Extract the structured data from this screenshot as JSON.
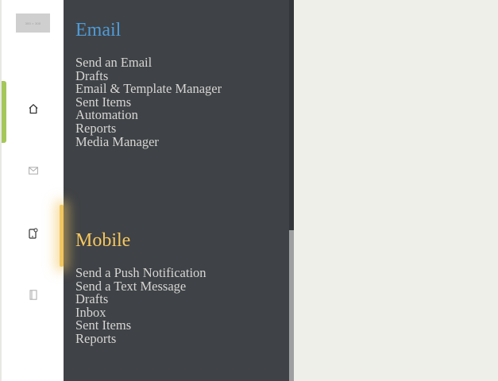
{
  "rail": {
    "logo_text": "300 × 300",
    "items": [
      {
        "icon": "home-icon",
        "name": "home"
      },
      {
        "icon": "mail-icon",
        "name": "email"
      },
      {
        "icon": "mobile-icon",
        "name": "mobile"
      },
      {
        "icon": "book-icon",
        "name": "book"
      }
    ],
    "active_color": "#a5c75a"
  },
  "email": {
    "title": "Email",
    "color": "#4f9bd8",
    "items": [
      "Send an Email",
      "Drafts",
      "Email & Template Manager",
      "Sent Items",
      "Automation",
      "Reports",
      "Media Manager"
    ]
  },
  "mobile": {
    "title": "Mobile",
    "color": "#f6c75d",
    "items": [
      "Send a Push Notification",
      "Send a Text Message",
      "Drafts",
      "Inbox",
      "Sent Items",
      "Reports"
    ]
  }
}
